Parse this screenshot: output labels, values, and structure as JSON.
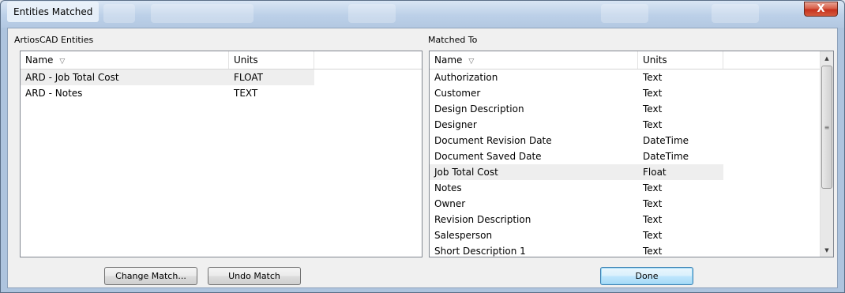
{
  "window": {
    "title": "Entities Matched",
    "close_glyph": "X"
  },
  "left_panel": {
    "label": "ArtiosCAD Entities",
    "columns": [
      "Name",
      "Units"
    ],
    "rows": [
      {
        "name": "ARD - Job Total Cost",
        "units": "FLOAT",
        "highlighted": true
      },
      {
        "name": "ARD - Notes",
        "units": "TEXT",
        "highlighted": false
      }
    ]
  },
  "right_panel": {
    "label": "Matched To",
    "columns": [
      "Name",
      "Units"
    ],
    "rows": [
      {
        "name": "Authorization",
        "units": "Text",
        "highlighted": false
      },
      {
        "name": "Customer",
        "units": "Text",
        "highlighted": false
      },
      {
        "name": "Design Description",
        "units": "Text",
        "highlighted": false
      },
      {
        "name": "Designer",
        "units": "Text",
        "highlighted": false
      },
      {
        "name": "Document Revision Date",
        "units": "DateTime",
        "highlighted": false
      },
      {
        "name": "Document Saved Date",
        "units": "DateTime",
        "highlighted": false
      },
      {
        "name": "Job Total Cost",
        "units": "Float",
        "highlighted": true
      },
      {
        "name": "Notes",
        "units": "Text",
        "highlighted": false
      },
      {
        "name": "Owner",
        "units": "Text",
        "highlighted": false
      },
      {
        "name": "Revision Description",
        "units": "Text",
        "highlighted": false
      },
      {
        "name": "Salesperson",
        "units": "Text",
        "highlighted": false
      },
      {
        "name": "Short Description 1",
        "units": "Text",
        "highlighted": false
      }
    ]
  },
  "buttons": {
    "change_match": "Change Match...",
    "undo_match": "Undo Match",
    "done": "Done"
  },
  "icons": {
    "sort": "sort-descending-icon",
    "close": "close-icon",
    "scroll_up": "scroll-up-arrow-icon",
    "scroll_down": "scroll-down-arrow-icon"
  },
  "colors": {
    "highlight_row": "#eeeeee",
    "default_button": "#bee6fd",
    "close_button": "#c5321e"
  }
}
